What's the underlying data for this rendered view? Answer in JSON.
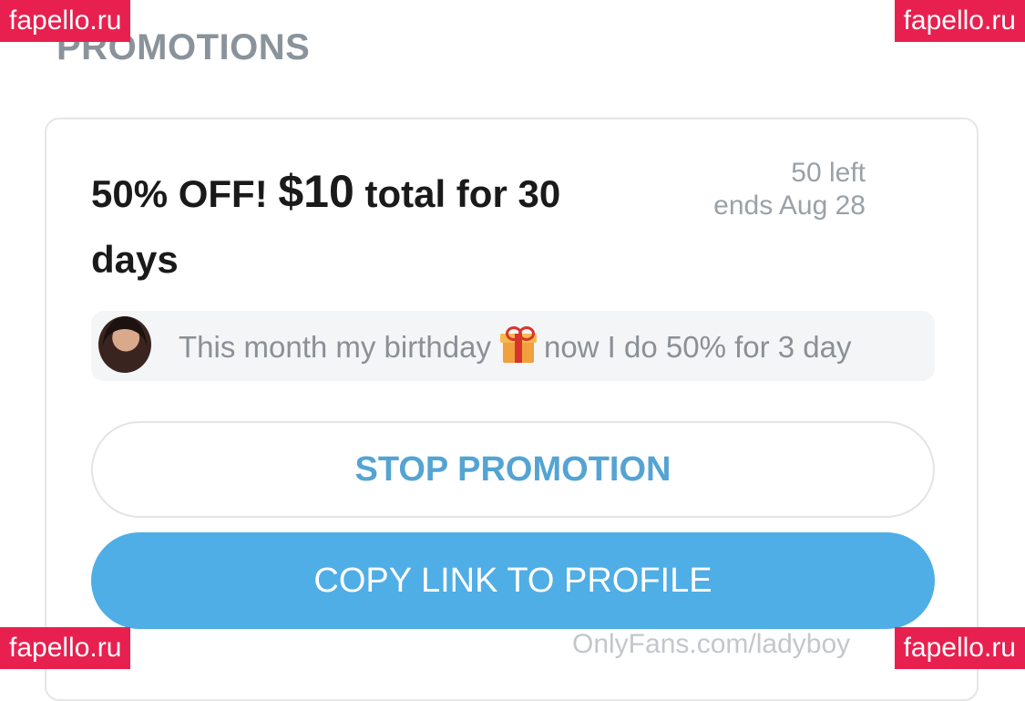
{
  "section": {
    "title": "PROMOTIONS"
  },
  "promo": {
    "title_prefix": "50% OFF!",
    "price": "$10",
    "title_suffix": "total for 30 days",
    "left": "50 left",
    "ends": "ends Aug 28",
    "message_start": "This month my birthday",
    "message_icon": "gift-icon",
    "message_end": "now I do 50% for 3 day"
  },
  "buttons": {
    "stop": "STOP PROMOTION",
    "copy": "COPY LINK TO PROFILE"
  },
  "footer": {
    "url": "OnlyFans.com/ladyboy"
  },
  "watermark": {
    "text": "fapello.ru"
  },
  "colors": {
    "accent": "#4faee5",
    "stop_text": "#54a4d3",
    "watermark": "#e8204f"
  }
}
